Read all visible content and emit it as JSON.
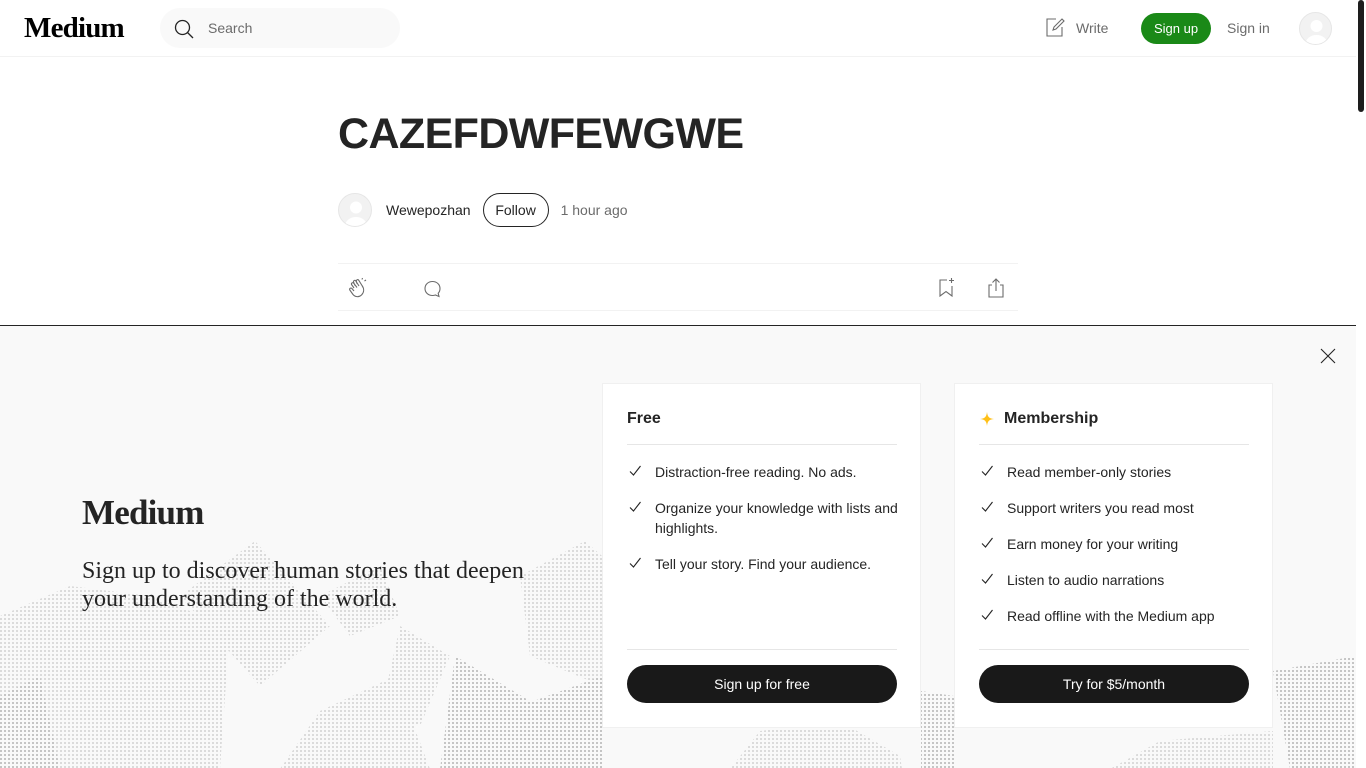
{
  "header": {
    "logo": "Medium",
    "search_placeholder": "Search",
    "write_label": "Write",
    "signup_label": "Sign up",
    "signin_label": "Sign in"
  },
  "article": {
    "title": "CAZEFDWFEWGWE",
    "author": "Wewepozhan",
    "follow_label": "Follow",
    "time": "1 hour ago"
  },
  "signup_overlay": {
    "logo": "Medium",
    "tagline": "Sign up to discover human stories that deepen your understanding of the world.",
    "free_plan": {
      "title": "Free",
      "features": [
        "Distraction-free reading. No ads.",
        "Organize your knowledge with lists and highlights.",
        "Tell your story. Find your audience."
      ],
      "cta": "Sign up for free"
    },
    "membership_plan": {
      "title": "Membership",
      "features": [
        "Read member-only stories",
        "Support writers you read most",
        "Earn money for your writing",
        "Listen to audio narrations",
        "Read offline with the Medium app"
      ],
      "cta": "Try for $5/month"
    }
  },
  "colors": {
    "signup_green": "#1a8917",
    "membership_star": "#ffc017",
    "dark_button": "#191919"
  },
  "icons": [
    "search-icon",
    "write-icon",
    "avatar-icon",
    "clap-icon",
    "comment-icon",
    "bookmark-icon",
    "share-icon",
    "close-icon",
    "check-icon",
    "star-icon"
  ]
}
